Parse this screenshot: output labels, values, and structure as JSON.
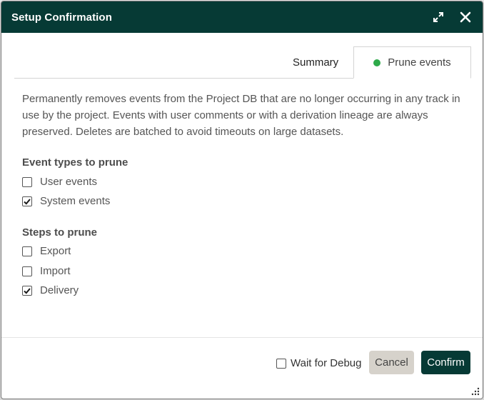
{
  "dialog": {
    "title": "Setup Confirmation",
    "expand_icon": "expand-icon",
    "close_icon": "close-icon"
  },
  "tabs": [
    {
      "label": "Summary",
      "active": false
    },
    {
      "label": "Prune events",
      "active": true,
      "status_color": "#2eaa4a"
    }
  ],
  "description": "Permanently removes events from the Project DB that are no longer occurring in any track in use by the project. Events with user comments or with a derivation lineage are always preserved. Deletes are batched to avoid timeouts on large datasets.",
  "event_types": {
    "title": "Event types to prune",
    "options": [
      {
        "label": "User events",
        "checked": false
      },
      {
        "label": "System events",
        "checked": true
      }
    ]
  },
  "steps": {
    "title": "Steps to prune",
    "options": [
      {
        "label": "Export",
        "checked": false
      },
      {
        "label": "Import",
        "checked": false
      },
      {
        "label": "Delivery",
        "checked": true
      }
    ]
  },
  "footer": {
    "debug_label": "Wait for Debug",
    "debug_checked": false,
    "cancel_label": "Cancel",
    "confirm_label": "Confirm"
  },
  "colors": {
    "header_bg": "#063a35",
    "accent": "#063a35",
    "cancel_bg": "#d6d2cb",
    "status_green": "#2eaa4a"
  }
}
